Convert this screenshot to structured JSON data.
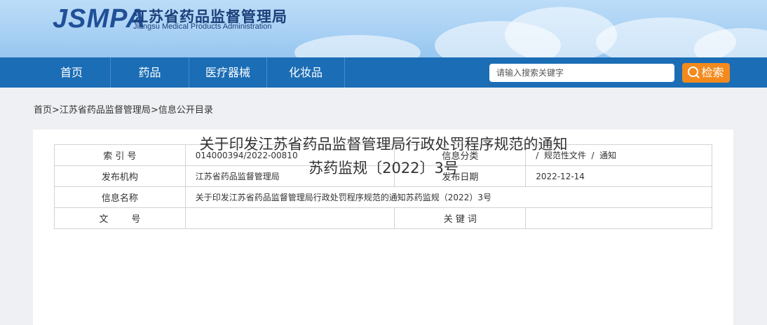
{
  "header": {
    "logo_mark": "JSMPA",
    "logo_cn": "江苏省药品监督管理局",
    "logo_en": "Jiangsu Medical Products Administration"
  },
  "nav": {
    "items": [
      "首页",
      "药品",
      "医疗器械",
      "化妆品"
    ],
    "search_placeholder": "请输入搜索关键字",
    "search_button": "检索"
  },
  "breadcrumb": {
    "home": "首页",
    "sep1": ">",
    "org": "江苏省药品监督管理局",
    "sep2": ">",
    "current": "信息公开目录"
  },
  "meta": {
    "index_label": "索 引 号",
    "index_value": "014000394/2022-00810",
    "category_label": "信息分类",
    "category_value": "/  规范性文件  /  通知",
    "issuer_label": "发布机构",
    "issuer_value": "江苏省药品监督管理局",
    "date_label": "发布日期",
    "date_value": "2022-12-14",
    "name_label": "信息名称",
    "name_value": "关于印发江苏省药品监督管理局行政处罚程序规范的通知苏药监规（2022）3号",
    "docno_label": "文        号",
    "docno_value": "",
    "keywords_label": "关 键 词",
    "keywords_value": ""
  },
  "article": {
    "title_line1": "关于印发江苏省药品监督管理局行政处罚程序规范的通知",
    "title_line2": "苏药监规〔2022〕3号"
  }
}
